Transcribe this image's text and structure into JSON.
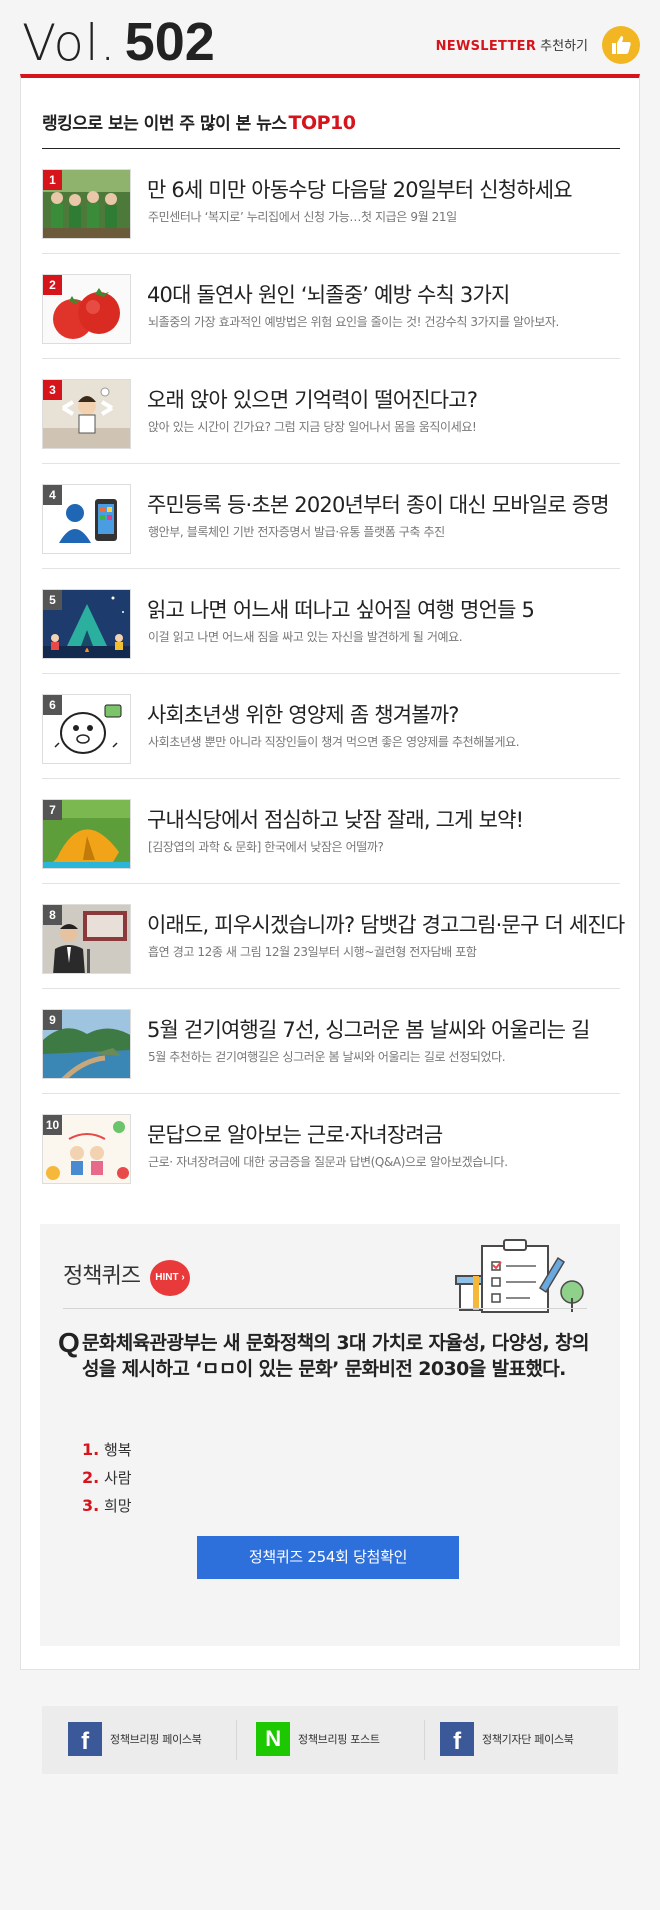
{
  "header": {
    "vol_prefix": "Vol.",
    "vol_number": "502",
    "newsletter_label": "NEWSLETTER",
    "recommend_label": "추천하기",
    "thumb_icon": "thumbs-up-icon"
  },
  "colors": {
    "accent": "#d6141c",
    "quiz_button": "#2d6fdb",
    "thumb": "#f3b623"
  },
  "ranking": {
    "title": "랭킹으로 보는 이번 주 많이 본 뉴스",
    "highlight": "TOP10",
    "items": [
      {
        "rank": "1",
        "title": "만 6세 미만 아동수당 다음달 20일부터 신청하세요",
        "desc": "주민센터나 ‘복지로’ 누리집에서 신청 가능…첫 지급은 9월 21일",
        "thumb_icon": "children-photo"
      },
      {
        "rank": "2",
        "title": "40대 돌연사 원인 ‘뇌졸중’ 예방 수칙 3가지",
        "desc": "뇌졸중의 가장 효과적인 예방법은 위험 요인을 줄이는 것! 건강수칙 3가지를 알아보자.",
        "thumb_icon": "tomato-photo"
      },
      {
        "rank": "3",
        "title": "오래 앉아 있으면 기억력이 떨어진다고?",
        "desc": "앉아 있는 시간이 긴가요? 그럼 지금 당장 일어나서 몸을 움직이세요!",
        "thumb_icon": "office-worker-illustration"
      },
      {
        "rank": "4",
        "title": "주민등록 등·초본 2020년부터 종이 대신 모바일로 증명",
        "desc": "행안부, 블록체인 기반 전자증명서 발급·유통 플랫폼 구축 추진",
        "thumb_icon": "mobile-phone-illustration"
      },
      {
        "rank": "5",
        "title": "읽고 나면 어느새 떠나고 싶어질 여행 명언들 5",
        "desc": "이걸 읽고 나면 어느새 짐을 싸고 있는 자신을 발견하게 될 거예요.",
        "thumb_icon": "camping-illustration"
      },
      {
        "rank": "6",
        "title": "사회초년생 위한 영양제 좀 챙겨볼까?",
        "desc": "사회초년생 뿐만 아니라 직장인들이 챙겨 먹으면 좋은 영양제를 추천해볼게요.",
        "thumb_icon": "cartoon-face-illustration"
      },
      {
        "rank": "7",
        "title": "구내식당에서 점심하고 낮잠 잘래, 그게 보약!",
        "desc": "[김장엽의 과학 & 문화] 한국에서 낮잠은 어떨까?",
        "thumb_icon": "tent-photo"
      },
      {
        "rank": "8",
        "title": "이래도, 피우시겠습니까? 담뱃갑 경고그림·문구 더 세진다",
        "desc": "흡연 경고 12종 새 그림 12월 23일부터 시행~궐련형 전자담배 포함",
        "thumb_icon": "briefing-photo"
      },
      {
        "rank": "9",
        "title": "5월 걷기여행길 7선, 싱그러운 봄 날씨와 어울리는 길",
        "desc": "5월 추천하는 걷기여행길은 싱그러운 봄 날씨와 어울리는 길로 선정되었다.",
        "thumb_icon": "coast-trail-photo"
      },
      {
        "rank": "10",
        "title": "문답으로 알아보는 근로·자녀장려금",
        "desc": "근로· 자녀장려금에 대한 궁금증을 질문과 답변(Q&A)으로 알아보겠습니다.",
        "thumb_icon": "family-illustration"
      }
    ]
  },
  "quiz": {
    "title": "정책퀴즈",
    "hint_label": "HINT",
    "q_mark": "Q",
    "question": "문화체육관광부는 새 문화정책의 3대 가치로 자율성, 다양성, 창의성을 제시하고 ‘ㅁㅁ이 있는 문화’ 문화비전 2030을 발표했다.",
    "options": [
      {
        "num": "1.",
        "text": "행복"
      },
      {
        "num": "2.",
        "text": "사람"
      },
      {
        "num": "3.",
        "text": "희망"
      }
    ],
    "button_label": "정책퀴즈 254회 당첨확인",
    "illustration_icon": "clipboard-checklist-icon"
  },
  "footer": {
    "items": [
      {
        "icon": "facebook-icon",
        "glyph": "f",
        "label": "정책브리핑 페이스북"
      },
      {
        "icon": "naver-icon",
        "glyph": "N",
        "label": "정책브리핑 포스트"
      },
      {
        "icon": "facebook-icon",
        "glyph": "f",
        "label": "정책기자단 페이스북"
      }
    ]
  }
}
